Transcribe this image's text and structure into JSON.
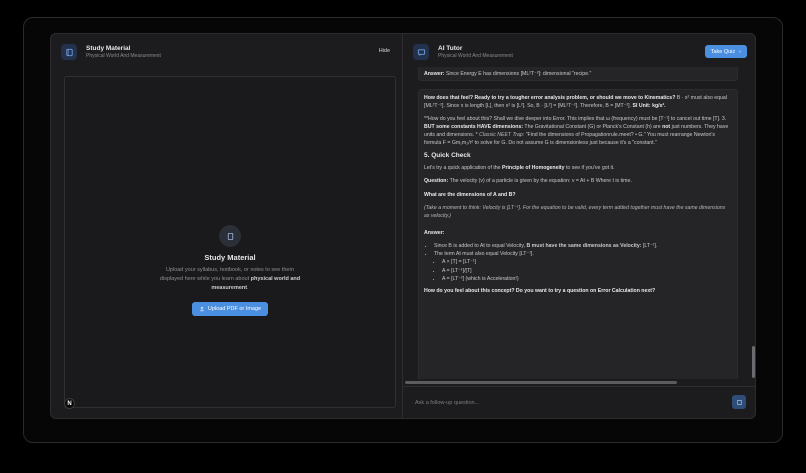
{
  "left": {
    "title": "Study Material",
    "subtitle": "Physical World And Measurement",
    "hide_label": "Hide",
    "empty_title": "Study Material",
    "empty_desc_plain": "Upload your syllabus, textbook, or notes to see them displayed here while you learn about ",
    "empty_desc_bold": "physical world and measurement",
    "empty_desc_end": ".",
    "upload_label": "Upload PDF or Image",
    "badge": "N"
  },
  "right": {
    "title": "AI Tutor",
    "subtitle": "Physical World And Measurement",
    "quiz_label": "Take Quiz"
  },
  "chat": {
    "b1_label": "Answer:",
    "b1_text": " Since Energy E has dimensions [ML²T⁻²]: dimensional \"recipe.\"",
    "q1_bold": "How does that feel? Ready to try a tougher error analysis problem, or should we move to Kinematics?",
    "q1_text": " B · x² must also equal [ML²T⁻²]. Since x is length [L], then x² is [L²]. So, B · [L²] = [ML²T⁻²]. Therefore, B = [MT⁻²]. ",
    "q1_unit_bold": "SI Unit: kg/s².",
    "p2a": "**How do you feel about this? Shall we dive deeper into Error. This implies that ω (frequency) must be [T⁻¹] to cancel out time [T]. 3. ",
    "p2b_bold": "BUT some constants HAVE dimensions:",
    "p2c": " The Gravitational Constant (G) or Planck's Constant (h) are ",
    "p2d_bold": "not",
    "p2e": " just numbers. They have units and dimensions. * ",
    "p2f_italic": "Classic NEET Trap:",
    "p2g": " \"Find the dimensions of Propagationrule.meet? • G.\" You must rearrange Newton's formula F = Gm₁m₂/r² to solve for G. Do not assume G is dimensionless just because it's a \"constant.\"",
    "section5": "5. Quick Check",
    "p3a": "Let's try a quick application of the ",
    "p3b_bold": "Principle of Homogeneity",
    "p3c": " to see if you've got it.",
    "q_label": "Question:",
    "q_text": " The velocity (v) of a particle is given by the equation: v = At + B Where t is time.",
    "q_dims": "What are the dimensions of A and B?",
    "hint": "(Take a moment to think: Velocity is [LT⁻¹]. For the equation to be valid, every term added together must have the same dimensions as velocity.)",
    "ans_label": "Answer:",
    "li1a": "Since B is added to At to equal Velocity, ",
    "li1b_bold": "B must have the same dimensions as Velocity:",
    "li1c": " [LT⁻¹].",
    "li2": "The term At must also equal Velocity [LT⁻¹].",
    "li2_sub1": "A × [T] = [LT⁻¹]",
    "li2_sub2": "A = [LT⁻¹]/[T]",
    "li2_sub3": "A = [LT⁻²] (which is Acceleration!)",
    "closing": "How do you feel about this concept? Do you want to try a question on Error Calculation next?"
  },
  "input": {
    "placeholder": "Ask a follow-up question..."
  },
  "colors": {
    "accent": "#4a8fe0",
    "background": "#1c1c1e"
  }
}
